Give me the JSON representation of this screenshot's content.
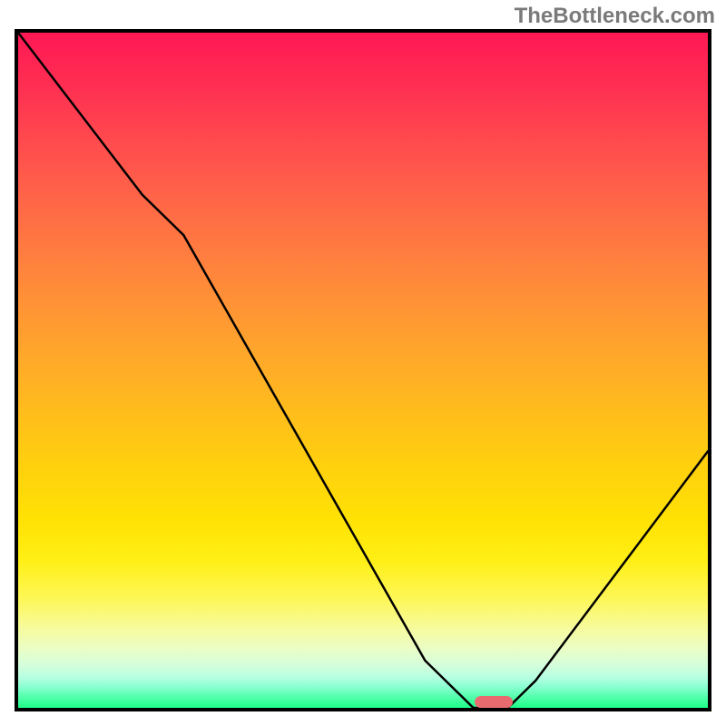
{
  "watermark": "TheBottleneck.com",
  "chart_data": {
    "type": "line",
    "title": "",
    "xlabel": "",
    "ylabel": "",
    "xlim": [
      0,
      100
    ],
    "ylim": [
      0,
      100
    ],
    "legend": false,
    "grid": false,
    "series": [
      {
        "name": "bottleneck-curve",
        "x": [
          0,
          18,
          24,
          59,
          66,
          71,
          75,
          100
        ],
        "values": [
          100,
          76,
          70,
          7,
          0,
          0,
          4,
          38
        ]
      }
    ],
    "minimum_marker": {
      "x_center": 69,
      "y": 0,
      "width": 5
    },
    "gradient_stops": [
      {
        "pos": 0,
        "color": "#ff1854"
      },
      {
        "pos": 8,
        "color": "#ff2f52"
      },
      {
        "pos": 16,
        "color": "#ff4a4e"
      },
      {
        "pos": 24,
        "color": "#ff6348"
      },
      {
        "pos": 32,
        "color": "#ff7b40"
      },
      {
        "pos": 40,
        "color": "#ff9236"
      },
      {
        "pos": 48,
        "color": "#ffa82a"
      },
      {
        "pos": 56,
        "color": "#ffbc1c"
      },
      {
        "pos": 64,
        "color": "#ffd00e"
      },
      {
        "pos": 72,
        "color": "#ffe104"
      },
      {
        "pos": 78,
        "color": "#ffef14"
      },
      {
        "pos": 84,
        "color": "#fdf75a"
      },
      {
        "pos": 88,
        "color": "#f7fb9a"
      },
      {
        "pos": 91,
        "color": "#ecfdc2"
      },
      {
        "pos": 93.5,
        "color": "#d7feda"
      },
      {
        "pos": 95.5,
        "color": "#b6ffe2"
      },
      {
        "pos": 97,
        "color": "#86ffcf"
      },
      {
        "pos": 98.5,
        "color": "#4fffa9"
      },
      {
        "pos": 100,
        "color": "#1dff86"
      }
    ]
  }
}
